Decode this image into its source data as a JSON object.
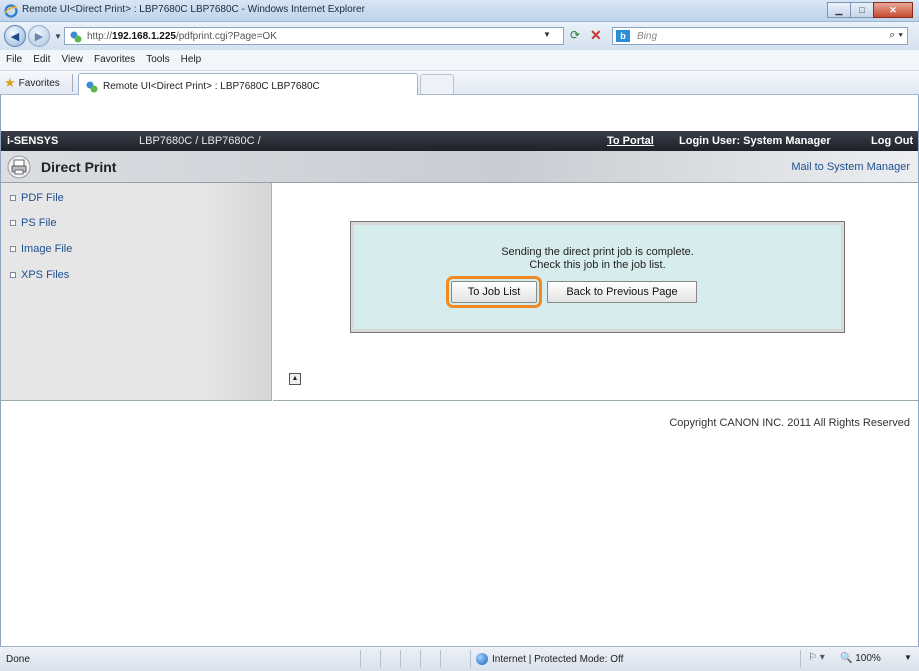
{
  "window": {
    "title": "Remote UI<Direct Print> : LBP7680C LBP7680C - Windows Internet Explorer"
  },
  "address": {
    "url_prefix": "http://",
    "url_host": "192.168.1.225",
    "url_path": "/pdfprint.cgi?Page=OK"
  },
  "search": {
    "placeholder": "Bing"
  },
  "menu": {
    "items": [
      "File",
      "Edit",
      "View",
      "Favorites",
      "Tools",
      "Help"
    ]
  },
  "favorites": {
    "label": "Favorites",
    "tab_title": "Remote UI<Direct Print> : LBP7680C LBP7680C"
  },
  "brandbar": {
    "brand": "i-SENSYS",
    "model": "LBP7680C / LBP7680C /",
    "portal": "To Portal",
    "login": "Login User: System Manager",
    "logout": "Log Out"
  },
  "header": {
    "title": "Direct Print",
    "mail": "Mail to System Manager"
  },
  "sidebar": {
    "items": [
      {
        "label": "PDF File"
      },
      {
        "label": "PS File"
      },
      {
        "label": "Image File"
      },
      {
        "label": "XPS Files"
      }
    ]
  },
  "dialog": {
    "line1": "Sending the direct print job is complete.",
    "line2": "Check this job in the job list.",
    "to_job_list": "To Job List",
    "back": "Back to Previous Page"
  },
  "footer": {
    "copyright": "Copyright CANON INC. 2011 All Rights Reserved"
  },
  "status": {
    "done": "Done",
    "zone": "Internet | Protected Mode: Off",
    "zoom": "100%"
  },
  "colors": {
    "highlight": "#f08a24",
    "dialog_bg": "#d7ecec",
    "link": "#1e4f8f"
  }
}
